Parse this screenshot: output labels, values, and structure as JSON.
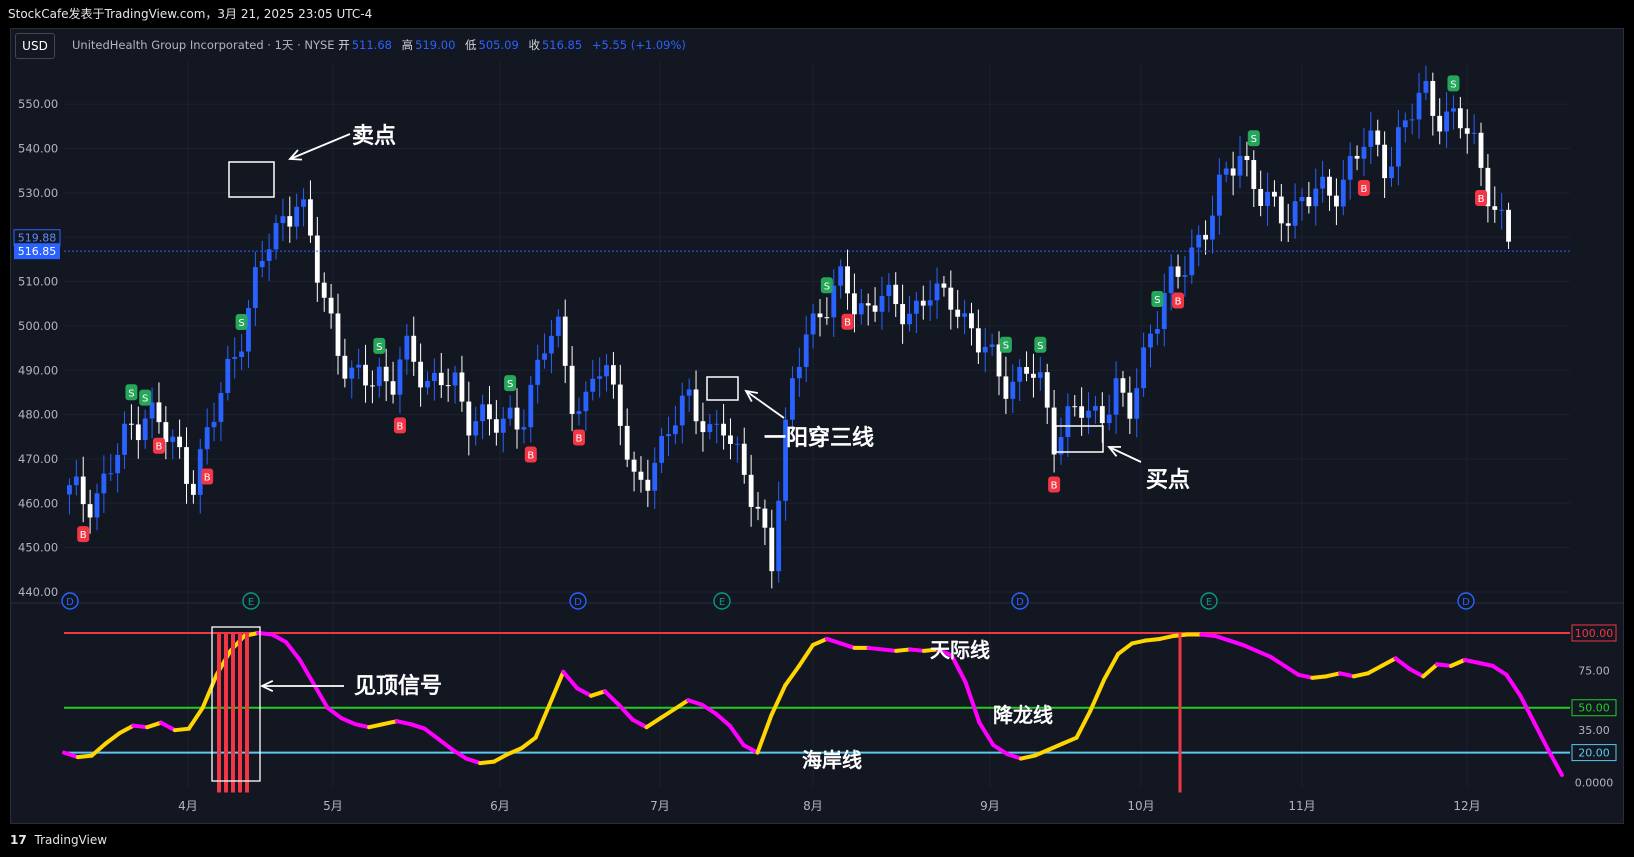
{
  "header": {
    "source": "StockCafe发表于TradingView.com，3月 21, 2025 23:05 UTC-4",
    "currency": "USD",
    "instrument": "UnitedHealth Group Incorporated · 1天 · NYSE",
    "open_label": "开",
    "open": "511.68",
    "high_label": "高",
    "high": "519.00",
    "low_label": "低",
    "low": "505.09",
    "close_label": "收",
    "close": "516.85",
    "change": "+5.55 (+1.09%)"
  },
  "footer": {
    "brand": "TradingView",
    "logo": "17"
  },
  "colors": {
    "background": "#131722",
    "up": "#2962ff",
    "down": "#ffffff",
    "osc_up": "#ffd600",
    "osc_down": "#ff00ff",
    "line_100": "#f23645",
    "line_50": "#22cc22",
    "line_20": "#5bc8f0"
  },
  "annotations": {
    "sell": "卖点",
    "buy": "买点",
    "yang": "一阳穿三线",
    "top_signal": "见顶信号",
    "sky": "天际线",
    "dragon": "降龙线",
    "coast": "海岸线"
  },
  "chart_data": [
    {
      "type": "candlestick",
      "title": "UnitedHealth Group Incorporated · 1天 · NYSE",
      "x_labels": [
        "4月",
        "5月",
        "6月",
        "7月",
        "8月",
        "9月",
        "10月",
        "11月",
        "12月"
      ],
      "y_ticks": [
        "550.00",
        "540.00",
        "530.00",
        "520.00",
        "510.00",
        "500.00",
        "490.00",
        "480.00",
        "470.00",
        "460.00",
        "450.00",
        "440.00"
      ],
      "ylim": [
        440,
        555
      ],
      "price_labels": {
        "prev": "519.88",
        "last": "516.85"
      },
      "close_path": [
        [
          0,
          462
        ],
        [
          5,
          461
        ],
        [
          10,
          463
        ],
        [
          15,
          470
        ],
        [
          20,
          477
        ],
        [
          25,
          482
        ],
        [
          30,
          476
        ],
        [
          35,
          471
        ],
        [
          40,
          466
        ],
        [
          45,
          475
        ],
        [
          52,
          492
        ],
        [
          58,
          504
        ],
        [
          64,
          518
        ],
        [
          70,
          526
        ],
        [
          74,
          529
        ],
        [
          77,
          520
        ],
        [
          80,
          512
        ],
        [
          84,
          503
        ],
        [
          88,
          493
        ],
        [
          92,
          486
        ],
        [
          96,
          488
        ],
        [
          100,
          490
        ],
        [
          104,
          487
        ],
        [
          108,
          493
        ],
        [
          112,
          491
        ],
        [
          116,
          488
        ],
        [
          120,
          489
        ],
        [
          124,
          486
        ],
        [
          128,
          478
        ],
        [
          132,
          482
        ],
        [
          136,
          479
        ],
        [
          140,
          476
        ],
        [
          146,
          480
        ],
        [
          150,
          488
        ],
        [
          154,
          496
        ],
        [
          158,
          498
        ],
        [
          162,
          486
        ],
        [
          166,
          480
        ],
        [
          170,
          490
        ],
        [
          174,
          488
        ],
        [
          178,
          482
        ],
        [
          183,
          462
        ],
        [
          187,
          464
        ],
        [
          191,
          472
        ],
        [
          195,
          482
        ],
        [
          199,
          483
        ],
        [
          203,
          478
        ],
        [
          207,
          476
        ],
        [
          211,
          481
        ],
        [
          215,
          470
        ],
        [
          219,
          463
        ],
        [
          223,
          458
        ],
        [
          227,
          448
        ],
        [
          229,
          462
        ],
        [
          232,
          478
        ],
        [
          235,
          490
        ],
        [
          238,
          500
        ],
        [
          242,
          503
        ],
        [
          246,
          506
        ],
        [
          250,
          509
        ],
        [
          254,
          506
        ],
        [
          258,
          504
        ],
        [
          262,
          507
        ],
        [
          266,
          503
        ],
        [
          270,
          505
        ],
        [
          274,
          504
        ],
        [
          278,
          507
        ],
        [
          282,
          505
        ],
        [
          286,
          508
        ],
        [
          290,
          500
        ],
        [
          294,
          495
        ],
        [
          298,
          492
        ],
        [
          302,
          489
        ],
        [
          306,
          487
        ],
        [
          310,
          490
        ],
        [
          314,
          486
        ],
        [
          318,
          476
        ],
        [
          322,
          478
        ],
        [
          326,
          481
        ],
        [
          330,
          479
        ],
        [
          334,
          482
        ],
        [
          338,
          486
        ],
        [
          342,
          478
        ],
        [
          346,
          490
        ],
        [
          350,
          502
        ],
        [
          354,
          507
        ],
        [
          358,
          510
        ],
        [
          362,
          516
        ],
        [
          366,
          522
        ],
        [
          370,
          527
        ],
        [
          374,
          533
        ],
        [
          378,
          540
        ],
        [
          382,
          534
        ],
        [
          386,
          528
        ],
        [
          390,
          524
        ],
        [
          394,
          526
        ],
        [
          398,
          529
        ],
        [
          402,
          530
        ],
        [
          406,
          528
        ],
        [
          410,
          532
        ],
        [
          414,
          537
        ],
        [
          418,
          541
        ],
        [
          422,
          539
        ],
        [
          426,
          537
        ],
        [
          430,
          544
        ],
        [
          434,
          548
        ],
        [
          438,
          552
        ],
        [
          442,
          549
        ],
        [
          446,
          547
        ],
        [
          450,
          545
        ],
        [
          454,
          540
        ],
        [
          458,
          533
        ],
        [
          462,
          524
        ],
        [
          465,
          518
        ]
      ],
      "markers": [
        {
          "i": 9,
          "kind": "S"
        },
        {
          "i": 11,
          "kind": "S"
        },
        {
          "i": 2,
          "kind": "B"
        },
        {
          "i": 13,
          "kind": "B"
        },
        {
          "i": 20,
          "kind": "B"
        },
        {
          "i": 25,
          "kind": "S"
        },
        {
          "i": 45,
          "kind": "S"
        },
        {
          "i": 48,
          "kind": "B"
        },
        {
          "i": 64,
          "kind": "S"
        },
        {
          "i": 67,
          "kind": "B"
        },
        {
          "i": 74,
          "kind": "B"
        },
        {
          "i": 110,
          "kind": "S"
        },
        {
          "i": 113,
          "kind": "B"
        },
        {
          "i": 136,
          "kind": "S"
        },
        {
          "i": 143,
          "kind": "B"
        },
        {
          "i": 141,
          "kind": "S"
        },
        {
          "i": 158,
          "kind": "S"
        },
        {
          "i": 161,
          "kind": "B"
        },
        {
          "i": 172,
          "kind": "S"
        },
        {
          "i": 188,
          "kind": "B"
        },
        {
          "i": 201,
          "kind": "S"
        },
        {
          "i": 205,
          "kind": "B"
        }
      ],
      "event_badges": [
        "D",
        "E",
        "D",
        "E",
        "D",
        "E",
        "D"
      ]
    },
    {
      "type": "area",
      "title": "",
      "y_ticks": [
        "100.00",
        "75.00",
        "50.00",
        "35.00",
        "20.00",
        "0.0000"
      ],
      "ylim": [
        -3,
        104
      ],
      "levels": [
        100,
        50,
        20
      ],
      "level_labels": [
        "100.00",
        "50.00",
        "20.00"
      ],
      "level_names": [
        "天际线",
        "降龙线",
        "海岸线"
      ],
      "values": [
        20,
        17,
        18,
        26,
        33,
        38,
        37,
        40,
        35,
        36,
        50,
        72,
        88,
        98,
        100,
        99,
        94,
        82,
        66,
        50,
        43,
        39,
        37,
        39,
        41,
        39,
        36,
        29,
        22,
        16,
        13,
        14,
        19,
        23,
        30,
        52,
        74,
        63,
        58,
        61,
        52,
        42,
        37,
        43,
        49,
        55,
        52,
        46,
        38,
        25,
        20,
        45,
        65,
        78,
        92,
        96,
        93,
        90,
        90,
        89,
        88,
        89,
        88,
        89,
        85,
        67,
        40,
        25,
        19,
        16,
        18,
        22,
        26,
        30,
        48,
        69,
        86,
        93,
        95,
        96,
        98,
        99,
        99,
        98,
        95,
        92,
        88,
        84,
        78,
        72,
        70,
        71,
        73,
        71,
        73,
        78,
        83,
        76,
        71,
        79,
        78,
        82,
        80,
        78,
        72,
        58,
        40,
        22,
        5
      ]
    }
  ]
}
